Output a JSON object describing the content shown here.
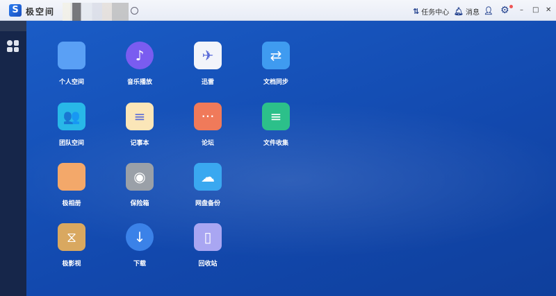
{
  "titlebar": {
    "app_name": "极空间",
    "logo_glyph": "S",
    "tasks_label": "任务中心",
    "messages_label": "消息",
    "minimize": "–",
    "maximize": "□",
    "close": "✕"
  },
  "apps": [
    {
      "label": "个人空间",
      "icon": "folder-icon",
      "glyph": "",
      "color": "#5aa0f5"
    },
    {
      "label": "音乐播放",
      "icon": "music-icon",
      "glyph": "♪",
      "color": "#7a5cf0"
    },
    {
      "label": "迅雷",
      "icon": "thunder-bird-icon",
      "glyph": "✈",
      "color": "#f2f4fa"
    },
    {
      "label": "文档同步",
      "icon": "doc-sync-icon",
      "glyph": "⇄",
      "color": "#3f9bf0"
    },
    {
      "label": "团队空间",
      "icon": "team-folder-icon",
      "glyph": "👥",
      "color": "#28b8e8"
    },
    {
      "label": "记事本",
      "icon": "notepad-icon",
      "glyph": "≡",
      "color": "#fbe6b8"
    },
    {
      "label": "论坛",
      "icon": "forum-icon",
      "glyph": "···",
      "color": "#f07a5a"
    },
    {
      "label": "文件收集",
      "icon": "file-collect-icon",
      "glyph": "≡",
      "color": "#2cc08a"
    },
    {
      "label": "极相册",
      "icon": "photo-album-icon",
      "glyph": "",
      "color": "#f3a86a"
    },
    {
      "label": "保险箱",
      "icon": "safe-icon",
      "glyph": "◉",
      "color": "#9aa0a8"
    },
    {
      "label": "网盘备份",
      "icon": "cloud-backup-icon",
      "glyph": "☁",
      "color": "#3aa8f0"
    },
    {
      "label": "极影视",
      "icon": "video-icon",
      "glyph": "⧖",
      "color": "#d9a860"
    },
    {
      "label": "下载",
      "icon": "download-globe-icon",
      "glyph": "↓",
      "color": "#3b82e8"
    },
    {
      "label": "回收站",
      "icon": "trash-icon",
      "glyph": "▯",
      "color": "#a9a6f2"
    }
  ]
}
